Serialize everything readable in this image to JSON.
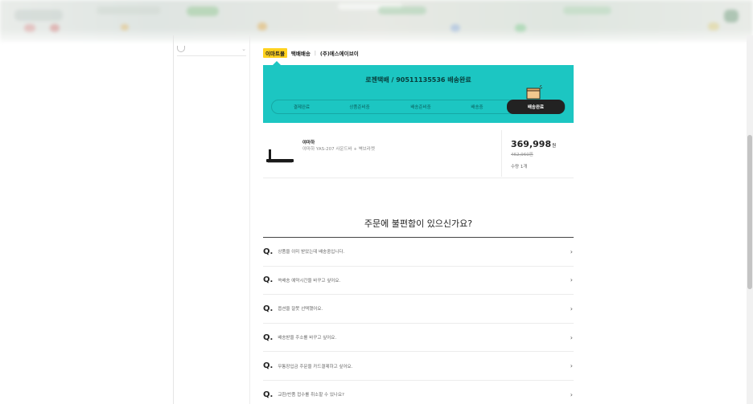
{
  "sidebar": {
    "item_label": "",
    "icon": "person-icon"
  },
  "seller": {
    "badge": "이마트몰",
    "delivery_type": "택배배송",
    "separator": "|",
    "company": "(주)에스에이브이"
  },
  "shipment": {
    "status_title": "로젠택배 / 90511135536 배송완료",
    "steps": [
      "결제완료",
      "상품준비중",
      "배송준비중",
      "배송중",
      "배송완료"
    ],
    "active_step": 4,
    "accent_color": "#1cc6c2"
  },
  "product": {
    "brand": "야마하",
    "name": "야마하 YAS-207 사운드바 + 벽브라켓",
    "price": "369,998",
    "price_unit": "원",
    "original_price": "462,960원",
    "quantity": "수량 1개"
  },
  "faq": {
    "title": "주문에 불편함이 있으신가요?",
    "q_mark": "Q.",
    "items": [
      "상품을 이미 받았는데 배송중입니다.",
      "쓱배송 예약시간을 바꾸고 싶어요.",
      "옵션을 잘못 선택했어요.",
      "배송받을 주소를 바꾸고 싶어요.",
      "무통장입금 주문을 카드결제하고 싶어요.",
      "교환/반품 접수를 취소할 수 있나요?"
    ]
  }
}
